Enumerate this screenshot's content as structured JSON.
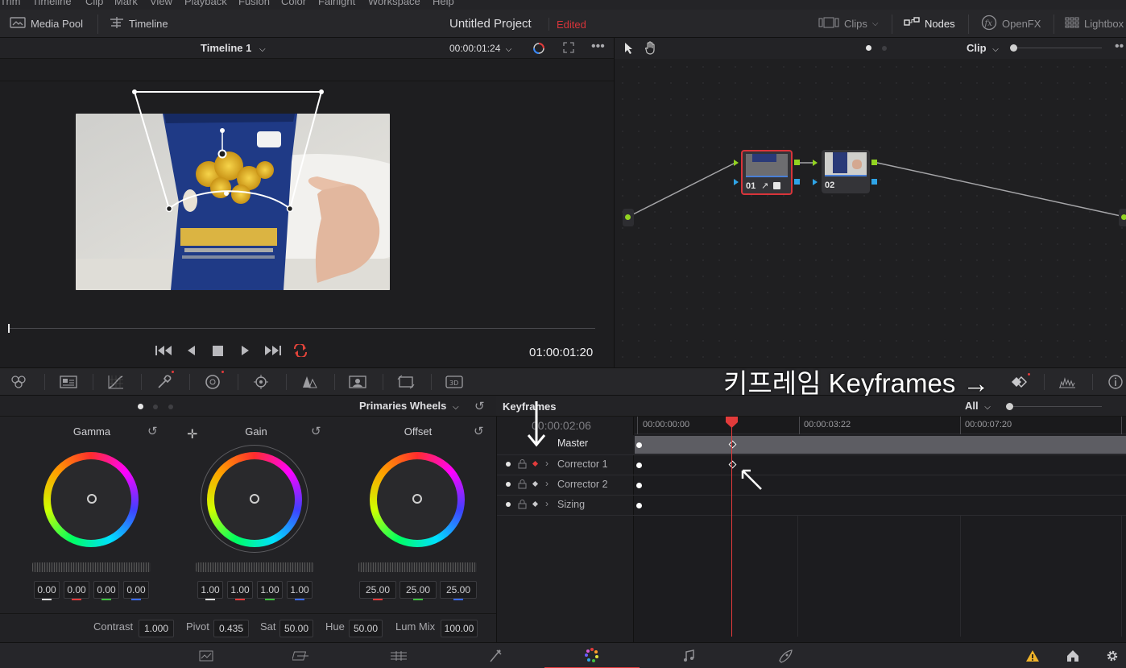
{
  "menu": [
    "Trim",
    "Timeline",
    "Clip",
    "Mark",
    "View",
    "Playback",
    "Fusion",
    "Color",
    "Fairlight",
    "Workspace",
    "Help"
  ],
  "header": {
    "media_pool": "Media Pool",
    "timeline": "Timeline",
    "project_title": "Untitled Project",
    "project_status": "Edited",
    "clips": "Clips",
    "nodes": "Nodes",
    "openfx": "OpenFX",
    "lightbox": "Lightbox"
  },
  "viewer": {
    "timeline_name": "Timeline 1",
    "timecode_top": "00:00:01:24",
    "timecode": "01:00:01:20"
  },
  "nodes": {
    "mode": "Clip",
    "node1_label": "01",
    "node2_label": "02"
  },
  "overlay": {
    "keyframes_label": "키프레임 Keyframes →"
  },
  "wheels": {
    "mode": "Primaries Wheels",
    "gamma": {
      "label": "Gamma",
      "values": [
        "0.00",
        "0.00",
        "0.00",
        "0.00"
      ]
    },
    "gain": {
      "label": "Gain",
      "values": [
        "1.00",
        "1.00",
        "1.00",
        "1.00"
      ]
    },
    "offset": {
      "label": "Offset",
      "values": [
        "25.00",
        "25.00",
        "25.00"
      ]
    }
  },
  "adjust": {
    "contrast_label": "Contrast",
    "contrast": "1.000",
    "pivot_label": "Pivot",
    "pivot": "0.435",
    "sat_label": "Sat",
    "sat": "50.00",
    "hue_label": "Hue",
    "hue": "50.00",
    "lummix_label": "Lum Mix",
    "lummix": "100.00"
  },
  "keyframes": {
    "title": "Keyframes",
    "filter": "All",
    "current_tc": "00:00:02:06",
    "ruler": [
      "00:00:00:00",
      "00:00:03:22",
      "00:00:07:20"
    ],
    "rows": [
      "Master",
      "Corrector 1",
      "Corrector 2",
      "Sizing"
    ]
  },
  "colors": {
    "accent_red": "#d8343a",
    "playhead": "#e23b3b",
    "node_border": "#d8343a"
  }
}
